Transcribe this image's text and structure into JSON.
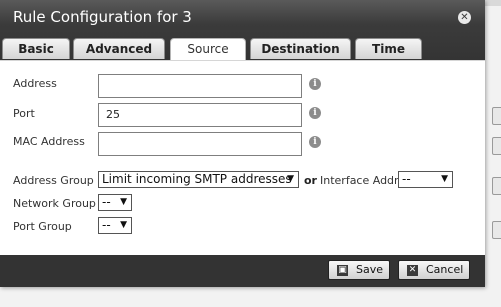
{
  "dialog": {
    "title": "Rule Configuration for 3",
    "close_icon": "close-icon",
    "tabs": [
      {
        "label": "Basic",
        "active": false
      },
      {
        "label": "Advanced",
        "active": false
      },
      {
        "label": "Source",
        "active": true
      },
      {
        "label": "Destination",
        "active": false
      },
      {
        "label": "Time",
        "active": false
      }
    ]
  },
  "form": {
    "address": {
      "label": "Address",
      "value": ""
    },
    "port": {
      "label": "Port",
      "value": "25"
    },
    "mac": {
      "label": "MAC Address",
      "value": ""
    },
    "address_group": {
      "label": "Address Group",
      "selected": "Limit incoming SMTP addresses"
    },
    "or_text": "or",
    "interface_addr": {
      "label": "Interface Addr",
      "selected": "--"
    },
    "network_group": {
      "label": "Network Group",
      "selected": "--"
    },
    "port_group": {
      "label": "Port Group",
      "selected": "--"
    }
  },
  "footer": {
    "save_label": "Save",
    "cancel_label": "Cancel"
  },
  "icons": {
    "info": "info-icon",
    "dropdown": "chevron-down-icon",
    "save": "save-icon",
    "cancel": "close-icon"
  }
}
